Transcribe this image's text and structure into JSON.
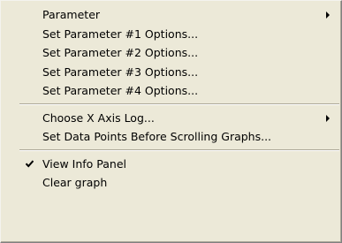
{
  "menu": {
    "items": [
      {
        "label": "Parameter",
        "submenu": true
      },
      {
        "label": "Set Parameter #1 Options..."
      },
      {
        "label": "Set Parameter #2 Options..."
      },
      {
        "label": "Set Parameter #3 Options..."
      },
      {
        "label": "Set Parameter #4 Options..."
      },
      {
        "label": "Choose X Axis Log...",
        "submenu": true
      },
      {
        "label": "Set Data Points Before Scrolling Graphs..."
      },
      {
        "label": "View Info Panel",
        "checked": true
      },
      {
        "label": "Clear graph"
      }
    ]
  },
  "icons": {
    "submenu_arrow": "triangle-right-icon",
    "check": "checkmark-icon"
  },
  "colors": {
    "menu_background": "#ece9d8",
    "separator": "#aca899",
    "text": "#000000"
  }
}
